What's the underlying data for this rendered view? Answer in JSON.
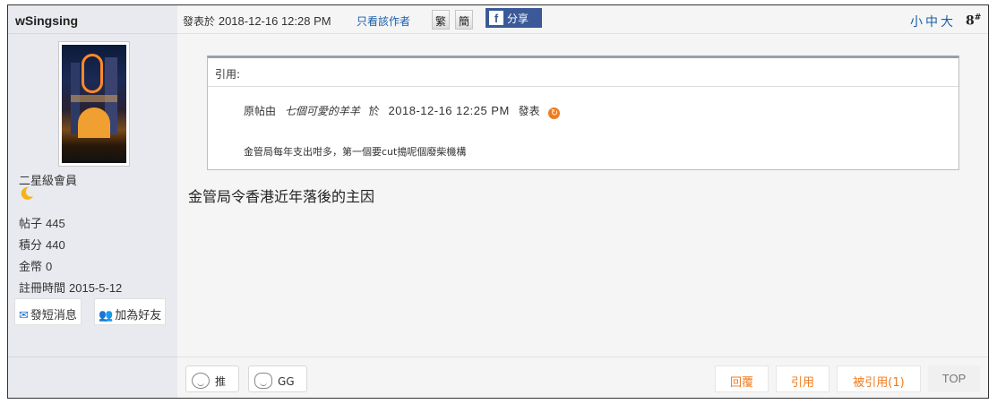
{
  "user": {
    "name": "wSingsing",
    "rank": "二星級會員",
    "stats": [
      {
        "label": "帖子",
        "value": "445"
      },
      {
        "label": "積分",
        "value": "440"
      },
      {
        "label": "金幣",
        "value": "0"
      },
      {
        "label": "註冊時間",
        "value": "2015-5-12"
      }
    ],
    "buttons": {
      "message": "發短消息",
      "add_friend": "加為好友"
    }
  },
  "post": {
    "posted_prefix": "發表於",
    "posted_time": "2018-12-16 12:28 PM",
    "only_author": "只看該作者",
    "trad": "繁",
    "simp": "簡",
    "share": "分享",
    "font_sizes": "小中大",
    "floor": "8",
    "floor_sup": "#",
    "quote": {
      "title": "引用:",
      "by_prefix": "原帖由",
      "author": "七個可愛的羊羊",
      "at": "於",
      "time": "2018-12-16  12:25  PM",
      "posted": "發表",
      "content": "金管局每年支出咁多，第一個要cut搗呢個廢柴機構"
    },
    "body": "金管局令香港近年落後的主因"
  },
  "actions": {
    "push": "推",
    "gg": "GG",
    "reply": "回覆",
    "quote": "引用",
    "quoted": "被引用(1)",
    "top": "TOP"
  },
  "colors": {
    "accent_orange": "#f07b1e",
    "link_blue": "#1a5ea8",
    "facebook": "#3b5998"
  }
}
